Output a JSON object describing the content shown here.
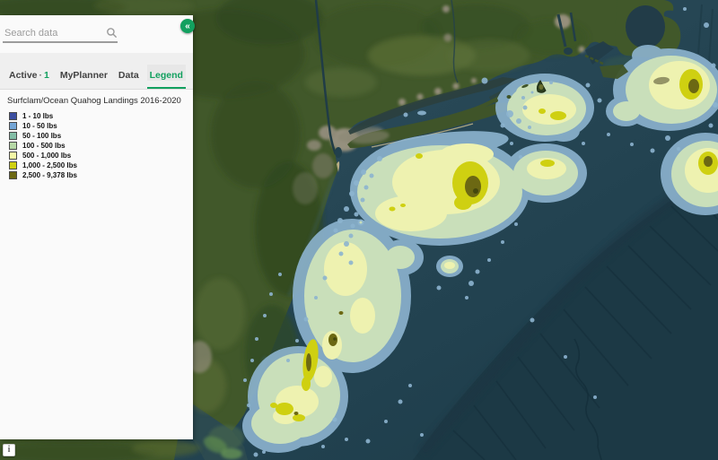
{
  "sidebar": {
    "search_placeholder": "Search data",
    "collapse_glyph": "«",
    "tabs": [
      {
        "label": "Active",
        "separator": "·",
        "count": "1"
      },
      {
        "label": "MyPlanner"
      },
      {
        "label": "Data"
      },
      {
        "label": "Legend",
        "active": true
      }
    ],
    "legend": {
      "title": "Surfclam/Ocean Quahog Landings 2016-2020",
      "items": [
        {
          "label": "1 - 10 lbs",
          "color": "#3d4fa1"
        },
        {
          "label": "10 - 50 lbs",
          "color": "#74a5d5"
        },
        {
          "label": "50 - 100 lbs",
          "color": "#83bda6"
        },
        {
          "label": "100 - 500 lbs",
          "color": "#b6d8a6"
        },
        {
          "label": "500 - 1,000 lbs",
          "color": "#f4f8a6"
        },
        {
          "label": "1,000 - 2,500 lbs",
          "color": "#cfd011"
        },
        {
          "label": "2,500 - 9,378 lbs",
          "color": "#6c6813"
        }
      ]
    }
  },
  "map": {
    "attribution_label": "i",
    "theme": {
      "accent": "#12a05f"
    },
    "heat_colors": {
      "blue": "#8db4d0",
      "green": "#c9dfba",
      "pale": "#eef2b0",
      "yellow": "#cfd011",
      "olive": "#6c6813",
      "dark": "#44470d"
    }
  }
}
